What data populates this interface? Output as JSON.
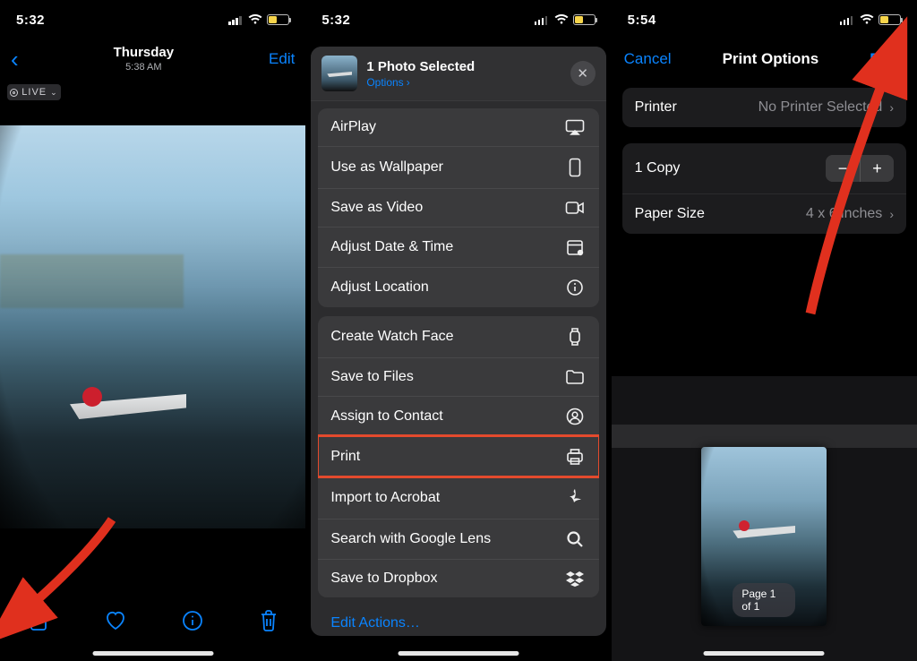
{
  "status": {
    "time_a": "5:32",
    "time_b": "5:32",
    "time_c": "5:54"
  },
  "screen1": {
    "nav": {
      "day": "Thursday",
      "subtime": "5:38 AM",
      "edit": "Edit"
    },
    "live_label": "LIVE"
  },
  "screen2": {
    "header": {
      "title": "1 Photo Selected",
      "options": "Options"
    },
    "group1": {
      "airplay": "AirPlay",
      "wallpaper": "Use as Wallpaper",
      "save_video": "Save as Video",
      "adjust_date": "Adjust Date & Time",
      "adjust_location": "Adjust Location"
    },
    "group2": {
      "watch_face": "Create Watch Face",
      "save_files": "Save to Files",
      "assign_contact": "Assign to Contact",
      "print": "Print",
      "acrobat": "Import to Acrobat",
      "google_lens": "Search with Google Lens",
      "dropbox": "Save to Dropbox"
    },
    "edit_actions": "Edit Actions…"
  },
  "screen3": {
    "nav": {
      "cancel": "Cancel",
      "title": "Print Options",
      "print": "Print"
    },
    "printer": {
      "label": "Printer",
      "value": "No Printer Selected"
    },
    "copies": {
      "label": "1 Copy"
    },
    "paper": {
      "label": "Paper Size",
      "value": "4 x 6 inches"
    },
    "page_badge": "Page 1 of 1"
  }
}
